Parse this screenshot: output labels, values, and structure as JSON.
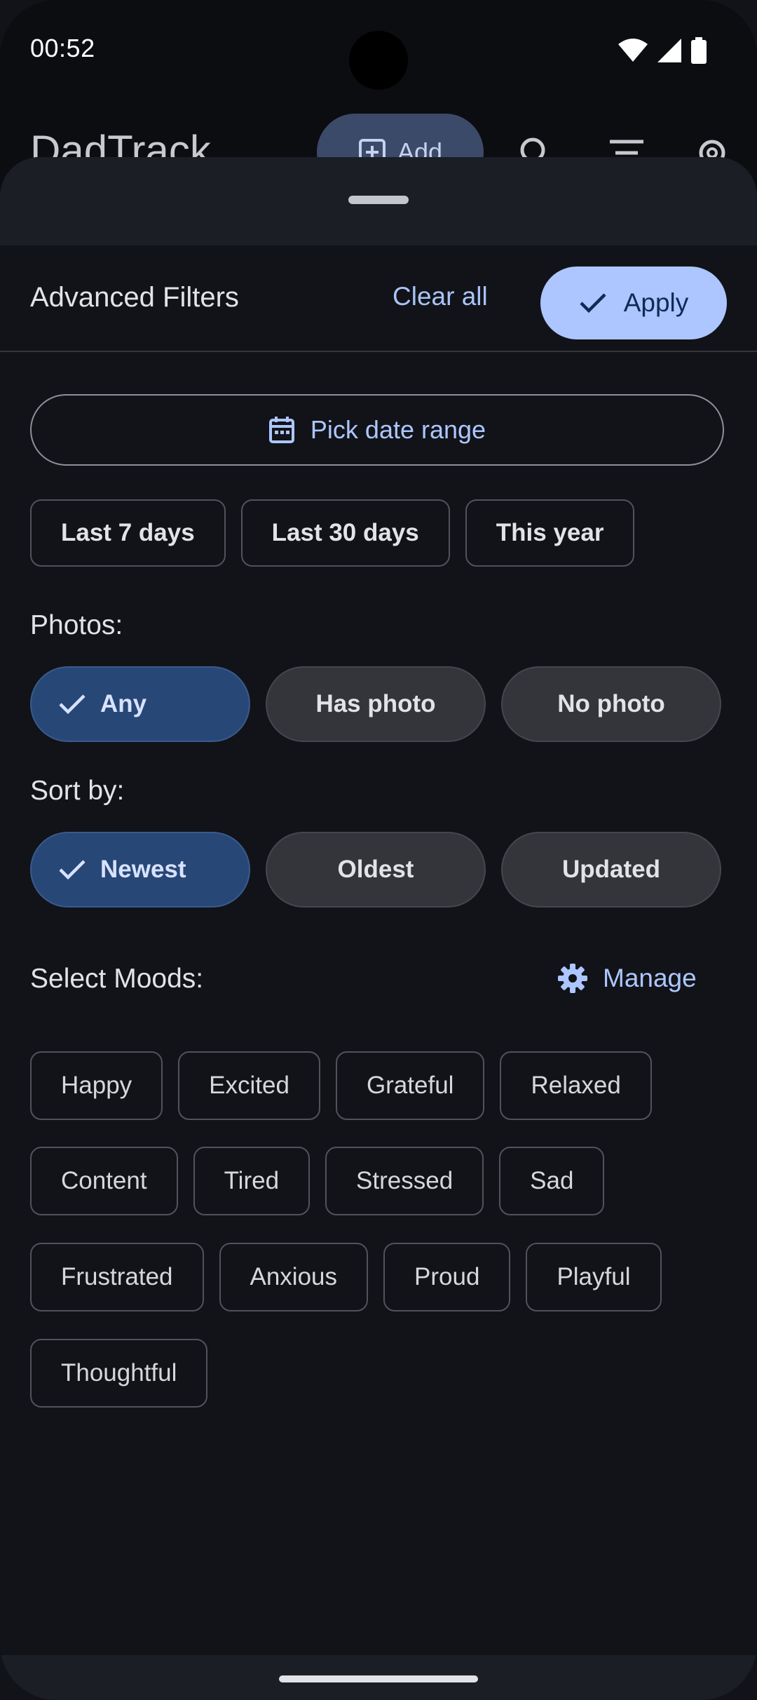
{
  "status_bar": {
    "time": "00:52"
  },
  "app_bar": {
    "title": "DadTrack",
    "add_label": "Add"
  },
  "sheet": {
    "title": "Advanced Filters",
    "clear_label": "Clear all",
    "apply_label": "Apply",
    "date_range_label": "Pick date range",
    "quick_ranges": [
      "Last 7 days",
      "Last 30 days",
      "This year"
    ],
    "photos_label": "Photos:",
    "photo_options": [
      "Any",
      "Has photo",
      "No photo"
    ],
    "photo_selected": "Any",
    "sort_label": "Sort by:",
    "sort_options": [
      "Newest",
      "Oldest",
      "Updated"
    ],
    "sort_selected": "Newest",
    "moods_label": "Select Moods:",
    "manage_label": "Manage",
    "moods": [
      [
        "Happy",
        "Excited",
        "Grateful",
        "Relaxed"
      ],
      [
        "Content",
        "Tired",
        "Stressed",
        "Sad"
      ],
      [
        "Frustrated",
        "Anxious",
        "Proud",
        "Playful"
      ],
      [
        "Thoughtful"
      ]
    ]
  },
  "colors": {
    "accent": "#adc6ff",
    "selected_segment": "#274776",
    "sheet_bg": "#111318"
  }
}
